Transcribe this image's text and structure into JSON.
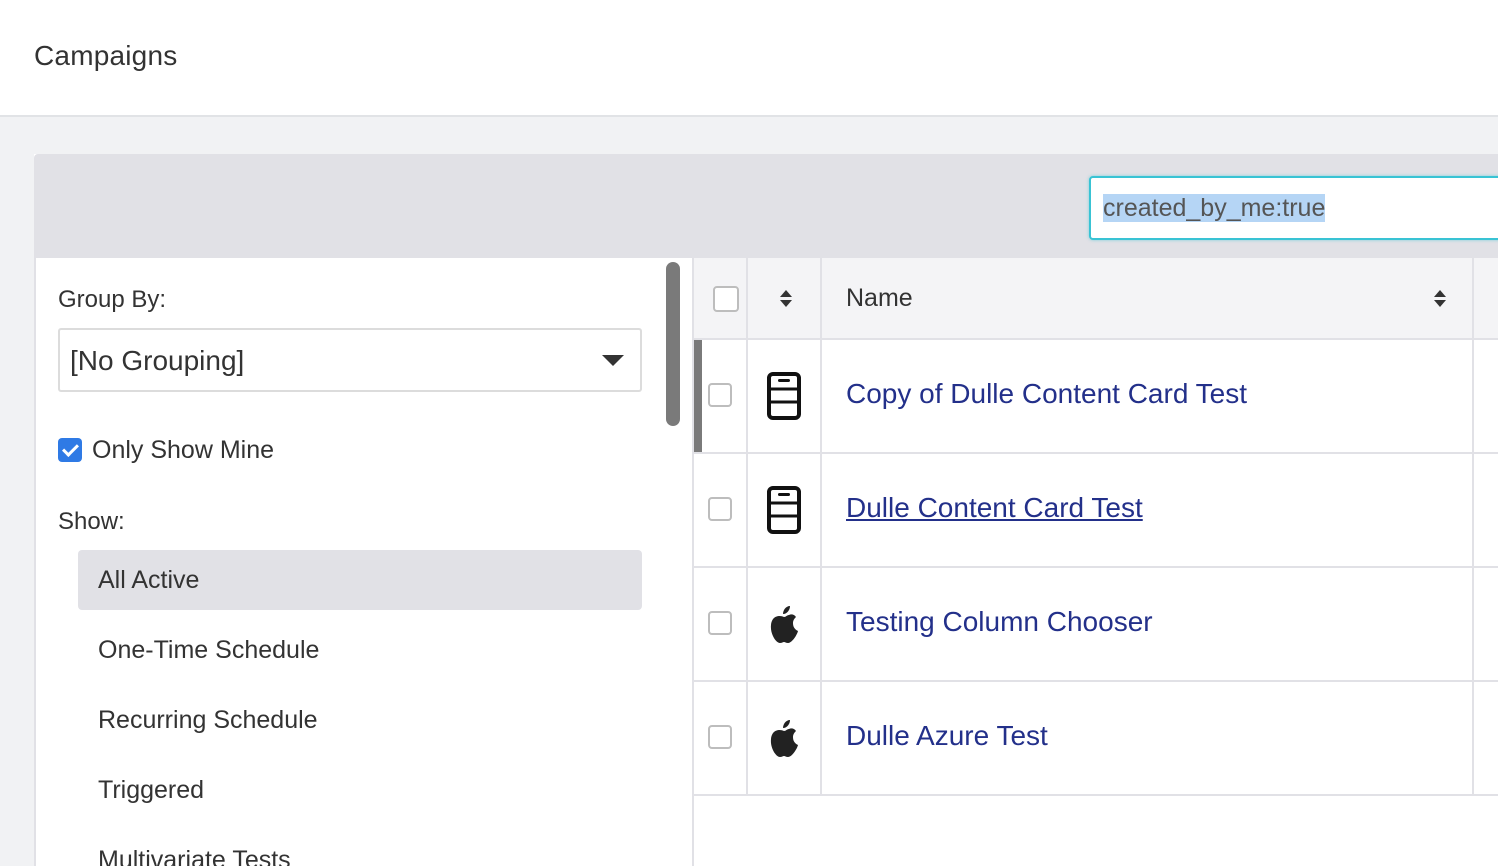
{
  "header": {
    "title": "Campaigns"
  },
  "search": {
    "value": "created_by_me:true"
  },
  "sidebar": {
    "group_by_label": "Group By:",
    "group_by_value": "[No Grouping]",
    "only_show_mine_label": "Only Show Mine",
    "only_show_mine_checked": true,
    "show_label": "Show:",
    "filters": [
      {
        "label": "All Active",
        "active": true
      },
      {
        "label": "One-Time Schedule",
        "active": false
      },
      {
        "label": "Recurring Schedule",
        "active": false
      },
      {
        "label": "Triggered",
        "active": false
      },
      {
        "label": "Multivariate Tests",
        "active": false
      }
    ]
  },
  "table": {
    "columns": {
      "name": "Name"
    },
    "rows": [
      {
        "name": "Copy of Dulle Content Card Test",
        "icon": "content-card-icon",
        "underline": false
      },
      {
        "name": "Dulle Content Card Test",
        "icon": "content-card-icon",
        "underline": true
      },
      {
        "name": "Testing Column Chooser",
        "icon": "apple-icon",
        "underline": false
      },
      {
        "name": "Dulle Azure Test",
        "icon": "apple-icon",
        "underline": false
      }
    ]
  },
  "colors": {
    "link": "#23308a",
    "accent": "#39c3d4",
    "checkbox": "#2f7ae5"
  }
}
